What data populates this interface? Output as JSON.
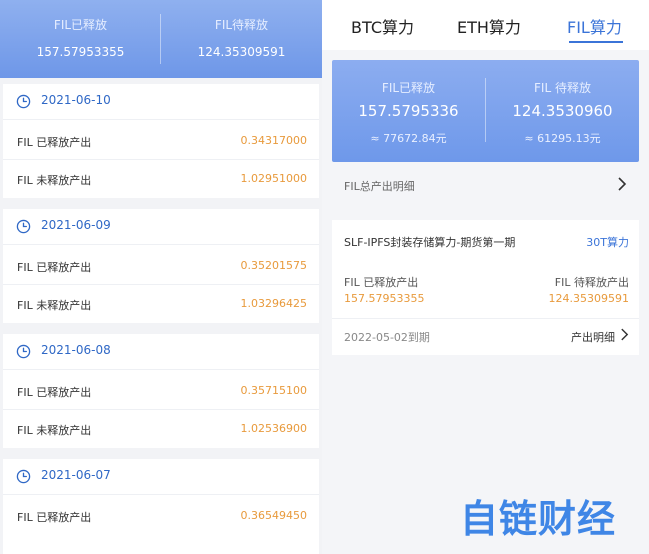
{
  "left": {
    "header": {
      "released_label": "FIL已释放",
      "released_value": "157.57953355",
      "pending_label": "FIL待释放",
      "pending_value": "124.35309591"
    },
    "days": [
      {
        "date": "2021-06-10",
        "released_label": "FIL 已释放产出",
        "released_value": "0.34317000",
        "unreleased_label": "FIL 未释放产出",
        "unreleased_value": "1.02951000"
      },
      {
        "date": "2021-06-09",
        "released_label": "FIL 已释放产出",
        "released_value": "0.35201575",
        "unreleased_label": "FIL 未释放产出",
        "unreleased_value": "1.03296425"
      },
      {
        "date": "2021-06-08",
        "released_label": "FIL 已释放产出",
        "released_value": "0.35715100",
        "unreleased_label": "FIL 未释放产出",
        "unreleased_value": "1.02536900"
      },
      {
        "date": "2021-06-07",
        "released_label": "FIL 已释放产出",
        "released_value": "0.36549450"
      }
    ]
  },
  "right": {
    "tabs": [
      "BTC算力",
      "ETH算力",
      "FIL算力"
    ],
    "active_tab": "FIL算力",
    "summary": {
      "released_label": "FIL已释放",
      "released_value": "157.5795336",
      "released_cny": "≈ 77672.84元",
      "pending_label": "FIL 待释放",
      "pending_value": "124.3530960",
      "pending_cny": "≈ 61295.13元"
    },
    "detail_link": "FIL总产出明细",
    "product": {
      "name": "SLF-IPFS封装存储算力-期货第一期",
      "tag": "30T算力",
      "released_label": "FIL 已释放产出",
      "released_value": "157.57953355",
      "pending_label": "FIL 待释放产出",
      "pending_value": "124.35309591",
      "expiry": "2022-05-02到期",
      "detail_link": "产出明细"
    }
  },
  "watermark": "自链财经",
  "colors": {
    "accent": "#3b74d8",
    "header_blue": "#7a9fec",
    "value_orange": "#e89a3c",
    "panel_bg": "#f4f5f8"
  }
}
